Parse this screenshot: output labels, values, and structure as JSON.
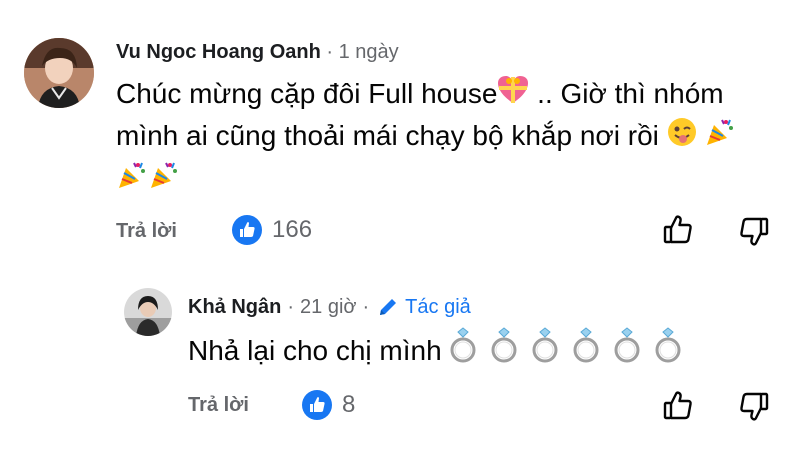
{
  "comment": {
    "author": "Vu Ngoc Hoang Oanh",
    "separator": "·",
    "time": "1 ngày",
    "text_line1": "Chúc mừng cặp đôi Full house",
    "text_line1_after": " .. Giờ thì nhóm",
    "text_line2": "mình ai cũng thoải mái chạy bộ khắp nơi rồi",
    "reply_label": "Trả lời",
    "like_count": "166"
  },
  "reply": {
    "author": "Khả Ngân",
    "separator": "·",
    "time": "21 giờ",
    "separator2": "·",
    "author_badge": "Tác giả",
    "text": "Nhả lại cho chị mình",
    "ring_count": 6,
    "reply_label": "Trả lời",
    "like_count": "8"
  },
  "icons": {
    "like_badge": "thumbs-up-icon",
    "like_button": "thumbs-up-outline-icon",
    "dislike_button": "thumbs-down-outline-icon",
    "pencil": "pencil-icon",
    "heart_gift": "gift-heart-emoji",
    "wink": "winking-tongue-emoji",
    "party": "party-popper-emoji",
    "ring": "ring-emoji"
  },
  "colors": {
    "accent": "#1877f2",
    "meta": "#65676b",
    "text": "#050505"
  }
}
